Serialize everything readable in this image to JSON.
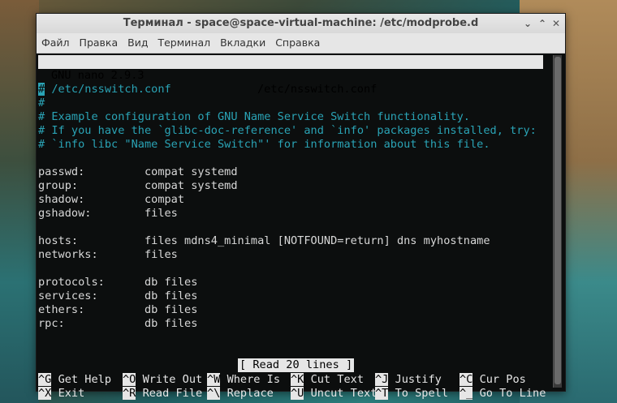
{
  "window": {
    "title": "Терминал - space@space-virtual-machine: /etc/modprobe.d",
    "minimize": "⌄",
    "maximize": "⌃",
    "close": "✕"
  },
  "menu": [
    "Файл",
    "Правка",
    "Вид",
    "Терминал",
    "Вкладки",
    "Справка"
  ],
  "nano": {
    "version": "GNU nano 2.9.3",
    "filename": "/etc/nsswitch.conf",
    "status": "[ Read 20 lines ]"
  },
  "file_lines": [
    {
      "text": " /etc/nsswitch.conf",
      "comment": true,
      "cursor": "#"
    },
    {
      "text": "#",
      "comment": true
    },
    {
      "text": "# Example configuration of GNU Name Service Switch functionality.",
      "comment": true
    },
    {
      "text": "# If you have the `glibc-doc-reference' and `info' packages installed, try:",
      "comment": true
    },
    {
      "text": "# `info libc \"Name Service Switch\"' for information about this file.",
      "comment": true
    },
    {
      "text": "",
      "comment": false
    },
    {
      "text": "passwd:         compat systemd",
      "comment": false
    },
    {
      "text": "group:          compat systemd",
      "comment": false
    },
    {
      "text": "shadow:         compat",
      "comment": false
    },
    {
      "text": "gshadow:        files",
      "comment": false
    },
    {
      "text": "",
      "comment": false
    },
    {
      "text": "hosts:          files mdns4_minimal [NOTFOUND=return] dns myhostname",
      "comment": false
    },
    {
      "text": "networks:       files",
      "comment": false
    },
    {
      "text": "",
      "comment": false
    },
    {
      "text": "protocols:      db files",
      "comment": false
    },
    {
      "text": "services:       db files",
      "comment": false
    },
    {
      "text": "ethers:         db files",
      "comment": false
    },
    {
      "text": "rpc:            db files",
      "comment": false
    }
  ],
  "shortcuts": {
    "row1": [
      {
        "key": "^G",
        "label": "Get Help"
      },
      {
        "key": "^O",
        "label": "Write Out"
      },
      {
        "key": "^W",
        "label": "Where Is"
      },
      {
        "key": "^K",
        "label": "Cut Text"
      },
      {
        "key": "^J",
        "label": "Justify"
      },
      {
        "key": "^C",
        "label": "Cur Pos"
      }
    ],
    "row2": [
      {
        "key": "^X",
        "label": "Exit"
      },
      {
        "key": "^R",
        "label": "Read File"
      },
      {
        "key": "^\\",
        "label": "Replace"
      },
      {
        "key": "^U",
        "label": "Uncut Text"
      },
      {
        "key": "^T",
        "label": "To Spell"
      },
      {
        "key": "^_",
        "label": "Go To Line"
      }
    ]
  }
}
